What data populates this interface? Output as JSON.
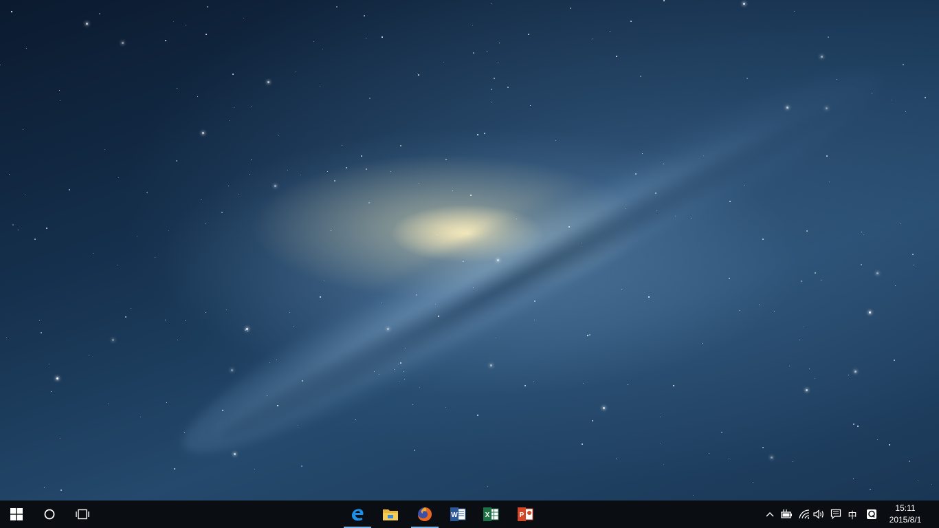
{
  "taskbar": {
    "start_label": "Start",
    "pinned_apps": [
      {
        "name": "Microsoft Edge",
        "icon": "edge-icon",
        "letter": "e",
        "color": "#1e7bd6",
        "active": true
      },
      {
        "name": "File Explorer",
        "icon": "folder-icon",
        "color": "#f0c040",
        "active": false
      },
      {
        "name": "Firefox",
        "icon": "firefox-icon",
        "color": "#e8671e",
        "active": true
      },
      {
        "name": "Word",
        "icon": "word-icon",
        "letter": "W",
        "color": "#2b5797",
        "active": false
      },
      {
        "name": "Excel",
        "icon": "excel-icon",
        "letter": "X",
        "color": "#1e7145",
        "active": false
      },
      {
        "name": "PowerPoint",
        "icon": "powerpoint-icon",
        "letter": "P",
        "color": "#d24726",
        "active": false
      }
    ],
    "tray": {
      "ime_label": "中",
      "qq_label": "Q",
      "time": "15:11",
      "date": "2015/8/1"
    }
  },
  "colors": {
    "taskbar_bg": "#0a0d12",
    "active_indicator": "#7fb6e8"
  }
}
